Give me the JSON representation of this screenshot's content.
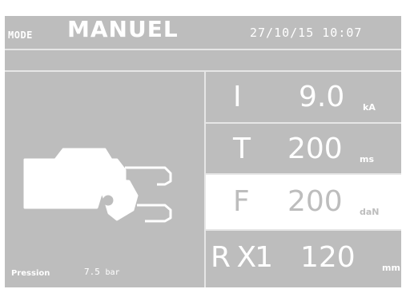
{
  "header": {
    "mode_label": "MODE",
    "mode_value": "MANUEL",
    "datetime": "27/10/15 10:07"
  },
  "pressure": {
    "label": "Pression",
    "value": "7.5",
    "unit": "bar"
  },
  "parameters": [
    {
      "symbol": "I",
      "value": "9.0",
      "unit": "kA"
    },
    {
      "symbol": "T",
      "value": "200",
      "unit": "ms"
    },
    {
      "symbol": "F",
      "value": "200",
      "unit": "daN"
    },
    {
      "symbol": "R X1",
      "value": "120",
      "unit": "mm"
    }
  ],
  "icons": {
    "welding_gun": "welding-gun-icon"
  },
  "colors": {
    "screen_bg": "#bdbdbd",
    "foreground": "#ffffff",
    "selected_bg": "#ffffff"
  }
}
